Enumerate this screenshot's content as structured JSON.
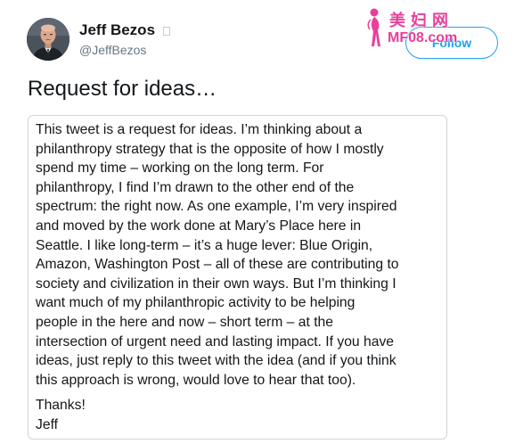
{
  "author": {
    "display_name": "Jeff Bezos",
    "handle": "@JeffBezos",
    "avatar_icon": "avatar-portrait"
  },
  "follow_button": {
    "label": "Follow",
    "color": "#1da1f2"
  },
  "tweet": {
    "text": "Request for ideas…"
  },
  "letter": {
    "body_lines": [
      "This tweet is a request for ideas. I’m thinking about a",
      "philanthropy strategy that is the opposite of how I mostly",
      "spend my time – working on the long term. For",
      "philanthropy, I find I’m drawn to the other end of the",
      "spectrum: the right now. As one example, I’m very inspired",
      "and moved by the work done at Mary’s Place here in",
      "Seattle. I like long-term – it’s a huge lever: Blue Origin,",
      "Amazon, Washington Post – all of these are contributing to",
      "society and civilization in their own ways. But I’m thinking I",
      "want much of my philanthropic activity to be helping",
      "people in the here and now – short term – at the",
      "intersection of urgent need and lasting impact. If you have",
      "ideas, just reply to this tweet with the idea (and if you think",
      "this approach is wrong, would love to hear that too)."
    ],
    "signoff_lines": [
      "Thanks!",
      "Jeff"
    ]
  },
  "watermark": {
    "title": "美妇网",
    "url": "MF08.com",
    "color": "#e8409a"
  }
}
